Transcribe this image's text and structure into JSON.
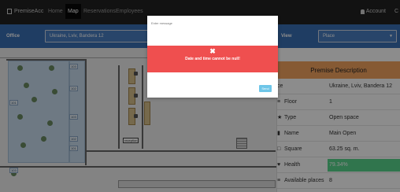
{
  "navbar": {
    "brand": "PremiseAcc",
    "links": [
      "Home",
      "Map",
      "Reservations",
      "Employees"
    ],
    "active": "Map",
    "account": "Account",
    "extra": "C"
  },
  "filters": {
    "office_label": "Office",
    "office_value": "Ukraine, Lviv, Bandera 12",
    "view_label": "View",
    "view_value": "Place"
  },
  "map": {
    "tags": [
      "103",
      "102",
      "101",
      "103",
      "102",
      "101",
      "103"
    ],
    "reception": "reception"
  },
  "panel": {
    "title": "Premise Description",
    "rows": [
      {
        "icon": "place-icon",
        "key": "ce",
        "value": "Ukraine, Lviv, Bandera 12"
      },
      {
        "icon": "list-icon",
        "key": "Floor",
        "value": "1"
      },
      {
        "icon": "star-icon",
        "key": "Type",
        "value": "Open space"
      },
      {
        "icon": "bar-chart-icon",
        "key": "Name",
        "value": "Main Open"
      },
      {
        "icon": "square-icon",
        "key": "Square",
        "value": "63.25 sq. m."
      },
      {
        "icon": "heart-icon",
        "key": "Health",
        "value": "79.34%"
      },
      {
        "icon": "list-icon",
        "key": "Available places",
        "value": "8"
      }
    ],
    "health_color": "#58d68d",
    "header_color": "#f4a460"
  },
  "modal": {
    "placeholder": "Enter message",
    "alert_icon": "close-icon",
    "alert_message": "Date and time cannot be null!",
    "button_label": "Send",
    "alert_color": "#ef4f4f"
  }
}
